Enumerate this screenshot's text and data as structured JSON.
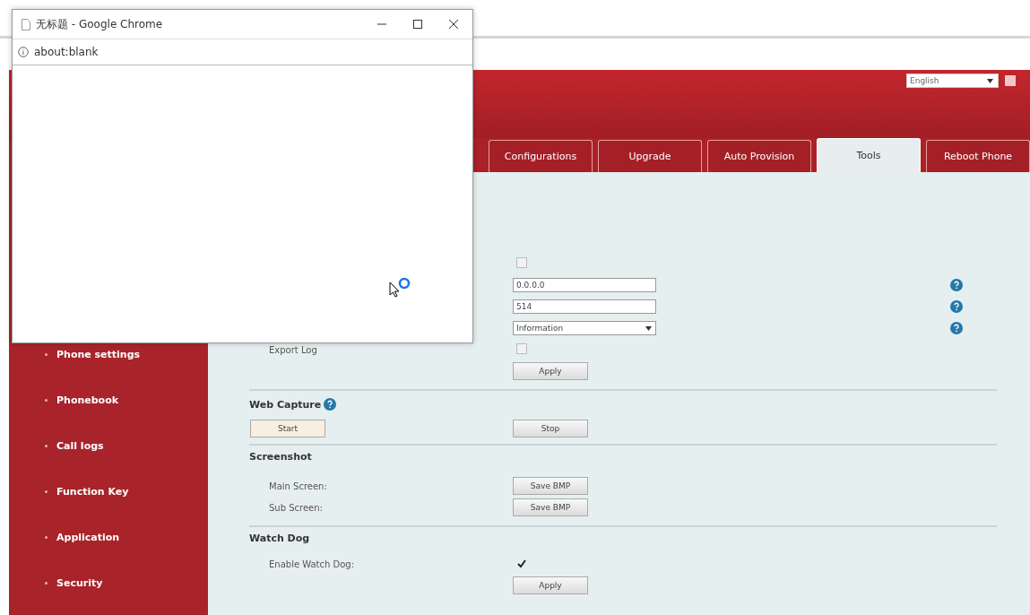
{
  "popup": {
    "title": "无标题 - Google Chrome",
    "address": "about:blank"
  },
  "header": {
    "language": "English"
  },
  "tabs": [
    {
      "label": "Configurations",
      "selected": false
    },
    {
      "label": "Upgrade",
      "selected": false
    },
    {
      "label": "Auto Provision",
      "selected": false
    },
    {
      "label": "Tools",
      "selected": true
    },
    {
      "label": "Reboot Phone",
      "selected": false
    }
  ],
  "sidebar": {
    "items": [
      {
        "label": "Phone settings"
      },
      {
        "label": "Phonebook"
      },
      {
        "label": "Call logs"
      },
      {
        "label": "Function Key"
      },
      {
        "label": "Application"
      },
      {
        "label": "Security"
      }
    ]
  },
  "syslog": {
    "enable": {
      "checked": false
    },
    "server": {
      "value": "0.0.0.0"
    },
    "port": {
      "value": "514"
    },
    "level": {
      "value": "Information"
    },
    "export_log": {
      "label": "Export Log",
      "checked": false
    },
    "apply": "Apply"
  },
  "web_capture": {
    "title": "Web Capture",
    "start": "Start",
    "stop": "Stop"
  },
  "screenshot": {
    "title": "Screenshot",
    "rows": [
      {
        "label": "Main Screen:",
        "button": "Save BMP"
      },
      {
        "label": "Sub Screen:",
        "button": "Save BMP"
      }
    ]
  },
  "watch_dog": {
    "title": "Watch Dog",
    "label": "Enable Watch Dog:",
    "checked": true,
    "apply": "Apply"
  }
}
